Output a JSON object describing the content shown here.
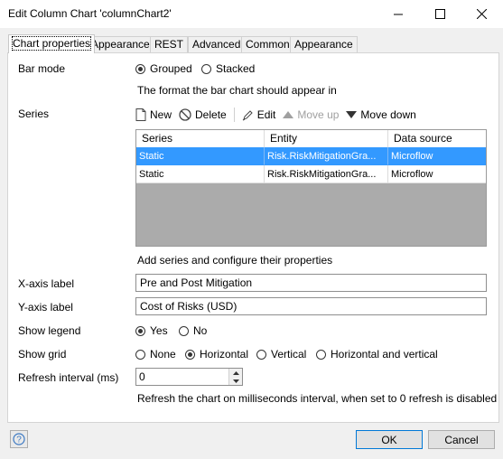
{
  "window": {
    "title": "Edit Column Chart 'columnChart2'"
  },
  "tabs": [
    "Chart properties",
    "Appearance",
    "REST",
    "Advanced",
    "Common",
    "Appearance"
  ],
  "bar_mode": {
    "label": "Bar mode",
    "options": [
      "Grouped",
      "Stacked"
    ],
    "selected": "Grouped",
    "hint": "The format the bar chart should appear in"
  },
  "series": {
    "label": "Series",
    "toolbar": {
      "new": "New",
      "delete": "Delete",
      "edit": "Edit",
      "move_up": "Move up",
      "move_down": "Move down"
    },
    "columns": [
      "Series",
      "Entity",
      "Data source"
    ],
    "rows": [
      [
        "Static",
        "Risk.RiskMitigationGra...",
        "Microflow"
      ],
      [
        "Static",
        "Risk.RiskMitigationGra...",
        "Microflow"
      ]
    ],
    "hint": "Add series and configure their properties"
  },
  "x_axis": {
    "label": "X-axis label",
    "value": "Pre and Post Mitigation"
  },
  "y_axis": {
    "label": "Y-axis label",
    "value": "Cost of Risks (USD)"
  },
  "legend": {
    "label": "Show legend",
    "options": [
      "Yes",
      "No"
    ],
    "selected": "Yes"
  },
  "grid": {
    "label": "Show grid",
    "options": [
      "None",
      "Horizontal",
      "Vertical",
      "Horizontal and vertical"
    ],
    "selected": "Horizontal"
  },
  "refresh": {
    "label": "Refresh interval (ms)",
    "value": "0",
    "hint": "Refresh the chart on milliseconds interval, when set to 0 refresh is disabled"
  },
  "buttons": {
    "ok": "OK",
    "cancel": "Cancel"
  }
}
